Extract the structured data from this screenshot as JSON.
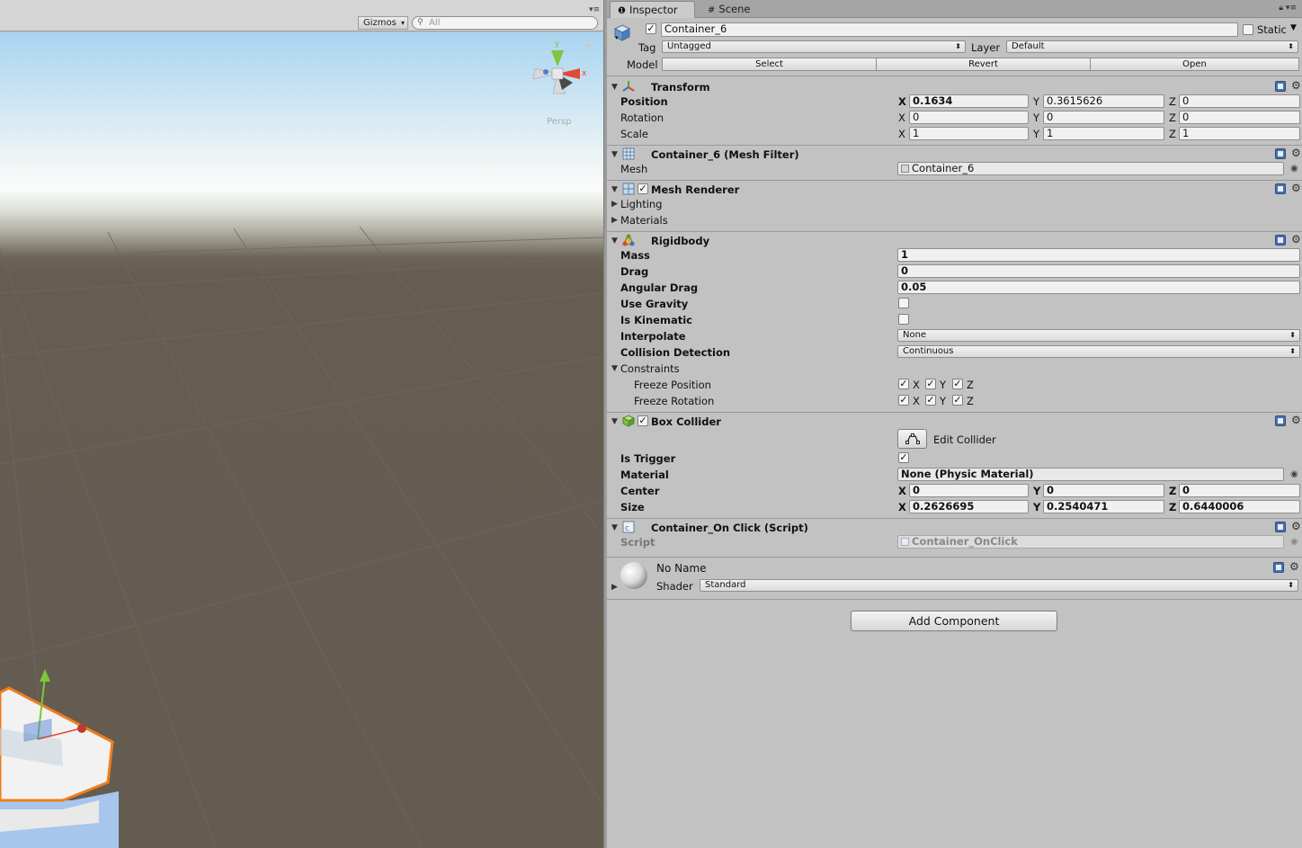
{
  "scene": {
    "gizmos_label": "Gizmos",
    "search_placeholder": "All",
    "persp_label": "Persp",
    "gizmo_axis_y": "y",
    "gizmo_axis_x": "x"
  },
  "tabs": [
    {
      "label": "Inspector",
      "icon": "info-icon"
    },
    {
      "label": "Scene",
      "icon": "grid-icon"
    }
  ],
  "header": {
    "object_name": "Container_6",
    "active": true,
    "static_label": "Static",
    "static_checked": false,
    "tag_label": "Tag",
    "tag_value": "Untagged",
    "layer_label": "Layer",
    "layer_value": "Default",
    "model_label": "Model",
    "model_buttons": [
      "Select",
      "Revert",
      "Open"
    ]
  },
  "transform": {
    "title": "Transform",
    "rows": [
      {
        "label": "Position",
        "x": "0.1634",
        "y": "0.3615626",
        "z": "0",
        "bold": true
      },
      {
        "label": "Rotation",
        "x": "0",
        "y": "0",
        "z": "0",
        "bold": false
      },
      {
        "label": "Scale",
        "x": "1",
        "y": "1",
        "z": "1",
        "bold": false
      }
    ]
  },
  "mesh_filter": {
    "title": "Container_6 (Mesh Filter)",
    "mesh_label": "Mesh",
    "mesh_value": "Container_6"
  },
  "mesh_renderer": {
    "title": "Mesh Renderer",
    "enabled": true,
    "lighting_label": "Lighting",
    "materials_label": "Materials"
  },
  "rigidbody": {
    "title": "Rigidbody",
    "mass_label": "Mass",
    "mass": "1",
    "drag_label": "Drag",
    "drag": "0",
    "angular_drag_label": "Angular Drag",
    "angular_drag": "0.05",
    "use_gravity_label": "Use Gravity",
    "use_gravity": false,
    "is_kinematic_label": "Is Kinematic",
    "is_kinematic": false,
    "interpolate_label": "Interpolate",
    "interpolate": "None",
    "collision_label": "Collision Detection",
    "collision": "Continuous",
    "constraints_label": "Constraints",
    "freeze_position_label": "Freeze Position",
    "freeze_rotation_label": "Freeze Rotation",
    "axis_x": "X",
    "axis_y": "Y",
    "axis_z": "Z"
  },
  "box_collider": {
    "title": "Box Collider",
    "enabled": true,
    "edit_collider_label": "Edit Collider",
    "is_trigger_label": "Is Trigger",
    "is_trigger": true,
    "material_label": "Material",
    "material": "None (Physic Material)",
    "center_label": "Center",
    "center": {
      "x": "0",
      "y": "0",
      "z": "0"
    },
    "size_label": "Size",
    "size": {
      "x": "0.2626695",
      "y": "0.2540471",
      "z": "0.6440006"
    }
  },
  "script_comp": {
    "title": "Container_On Click (Script)",
    "script_label": "Script",
    "script_value": "Container_OnClick"
  },
  "material": {
    "name": "No Name",
    "shader_label": "Shader",
    "shader_value": "Standard"
  },
  "add_component_label": "Add Component",
  "axis_labels": {
    "x": "X",
    "y": "Y",
    "z": "Z"
  },
  "colors": {
    "inspector_bg": "#c2c2c2",
    "selection_outline": "#f07d1c",
    "sky": "#a9d4f0",
    "ground": "#645c51"
  }
}
